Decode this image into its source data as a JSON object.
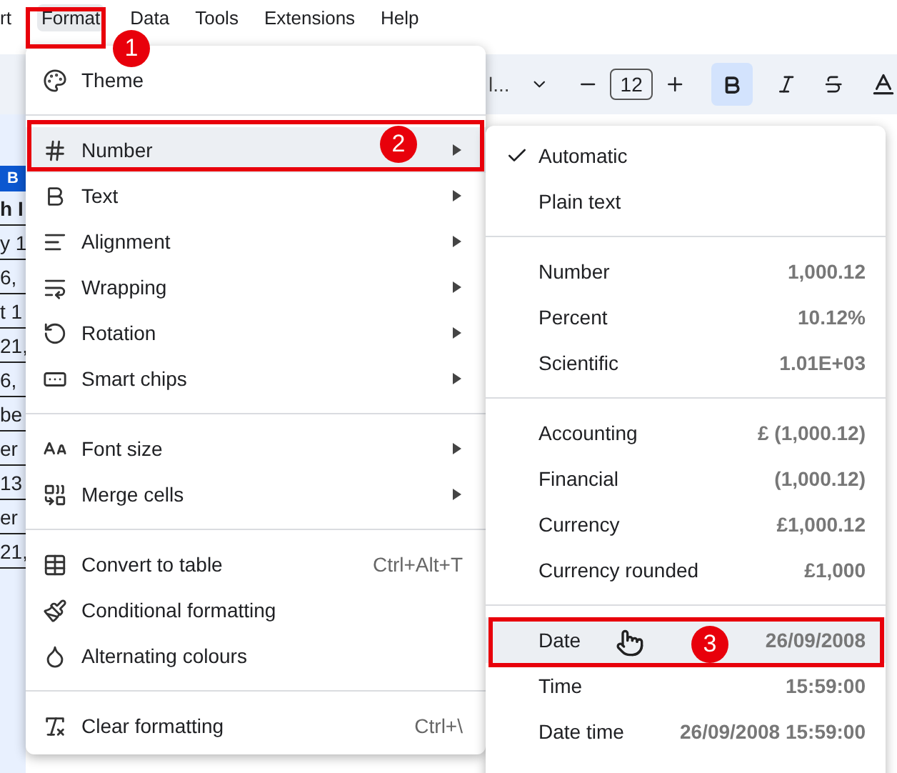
{
  "menu_bar": [
    {
      "label": "rt",
      "selected": false
    },
    {
      "label": "Format",
      "selected": true
    },
    {
      "label": "Data",
      "selected": false
    },
    {
      "label": "Tools",
      "selected": false
    },
    {
      "label": "Extensions",
      "selected": false
    },
    {
      "label": "Help",
      "selected": false
    }
  ],
  "toolbar": {
    "font": "l...",
    "font_size": "12",
    "bold": true
  },
  "sheet": {
    "column_header": "B",
    "cells": [
      {
        "text": "h I",
        "bold": true
      },
      {
        "text": "y 1",
        "bold": false
      },
      {
        "text": "6,",
        "bold": false
      },
      {
        "text": "t 1",
        "bold": false
      },
      {
        "text": "21,",
        "bold": false
      },
      {
        "text": "6,",
        "bold": false
      },
      {
        "text": "be",
        "bold": false
      },
      {
        "text": "er",
        "bold": false
      },
      {
        "text": "13",
        "bold": false
      },
      {
        "text": "er",
        "bold": false
      },
      {
        "text": "21,",
        "bold": false
      }
    ]
  },
  "format_menu": {
    "sections": [
      [
        {
          "label": "Theme",
          "submenu": false,
          "highlighted": false
        }
      ],
      [
        {
          "label": "Number",
          "submenu": true,
          "highlighted": true
        },
        {
          "label": "Text",
          "submenu": true,
          "highlighted": false
        },
        {
          "label": "Alignment",
          "submenu": true,
          "highlighted": false
        },
        {
          "label": "Wrapping",
          "submenu": true,
          "highlighted": false
        },
        {
          "label": "Rotation",
          "submenu": true,
          "highlighted": false
        },
        {
          "label": "Smart chips",
          "submenu": true,
          "highlighted": false
        }
      ],
      [
        {
          "label": "Font size",
          "submenu": true,
          "highlighted": false
        },
        {
          "label": "Merge cells",
          "submenu": true,
          "highlighted": false
        }
      ],
      [
        {
          "label": "Convert to table",
          "submenu": false,
          "highlighted": false,
          "shortcut": "Ctrl+Alt+T"
        },
        {
          "label": "Conditional formatting",
          "submenu": false,
          "highlighted": false
        },
        {
          "label": "Alternating colours",
          "submenu": false,
          "highlighted": false
        }
      ],
      [
        {
          "label": "Clear formatting",
          "submenu": false,
          "highlighted": false,
          "shortcut": "Ctrl+\\"
        }
      ]
    ]
  },
  "number_submenu": {
    "sections": [
      [
        {
          "label": "Automatic",
          "checked": true,
          "highlighted": false
        },
        {
          "label": "Plain text",
          "checked": false,
          "highlighted": false
        }
      ],
      [
        {
          "label": "Number",
          "value": "1,000.12",
          "highlighted": false
        },
        {
          "label": "Percent",
          "value": "10.12%",
          "highlighted": false
        },
        {
          "label": "Scientific",
          "value": "1.01E+03",
          "highlighted": false
        }
      ],
      [
        {
          "label": "Accounting",
          "value": "£ (1,000.12)",
          "highlighted": false
        },
        {
          "label": "Financial",
          "value": "(1,000.12)",
          "highlighted": false
        },
        {
          "label": "Currency",
          "value": "£1,000.12",
          "highlighted": false
        },
        {
          "label": "Currency rounded",
          "value": "£1,000",
          "highlighted": false
        }
      ],
      [
        {
          "label": "Date",
          "value": "26/09/2008",
          "highlighted": true
        },
        {
          "label": "Time",
          "value": "15:59:00",
          "highlighted": false
        },
        {
          "label": "Date time",
          "value": "26/09/2008 15:59:00",
          "highlighted": false
        }
      ]
    ]
  },
  "annotations": [
    {
      "number": "1"
    },
    {
      "number": "2"
    },
    {
      "number": "3"
    }
  ]
}
